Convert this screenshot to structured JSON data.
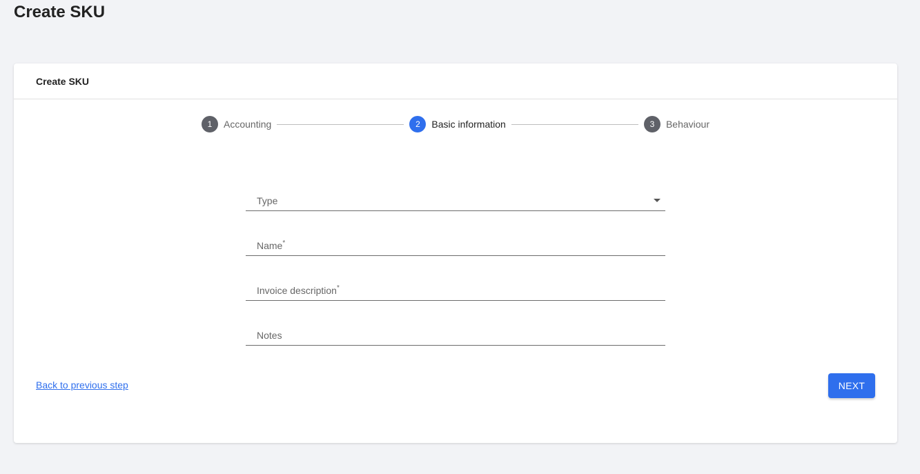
{
  "page": {
    "title": "Create SKU"
  },
  "card": {
    "title": "Create SKU"
  },
  "stepper": {
    "steps": [
      {
        "number": "1",
        "label": "Accounting",
        "state": "inactive"
      },
      {
        "number": "2",
        "label": "Basic information",
        "state": "active"
      },
      {
        "number": "3",
        "label": "Behaviour",
        "state": "inactive"
      }
    ]
  },
  "form": {
    "type": {
      "label": "Type",
      "value": "",
      "icon": "chevron-down-icon"
    },
    "name": {
      "label": "Name",
      "required_mark": "*",
      "value": ""
    },
    "invoice_description": {
      "label": "Invoice description",
      "required_mark": "*",
      "value": ""
    },
    "notes": {
      "label": "Notes",
      "value": ""
    }
  },
  "actions": {
    "back_label": "Back to previous step",
    "next_label": "NEXT"
  },
  "colors": {
    "accent": "#2f6fed",
    "step_inactive": "#5f6168",
    "background": "#f2f3f6"
  }
}
